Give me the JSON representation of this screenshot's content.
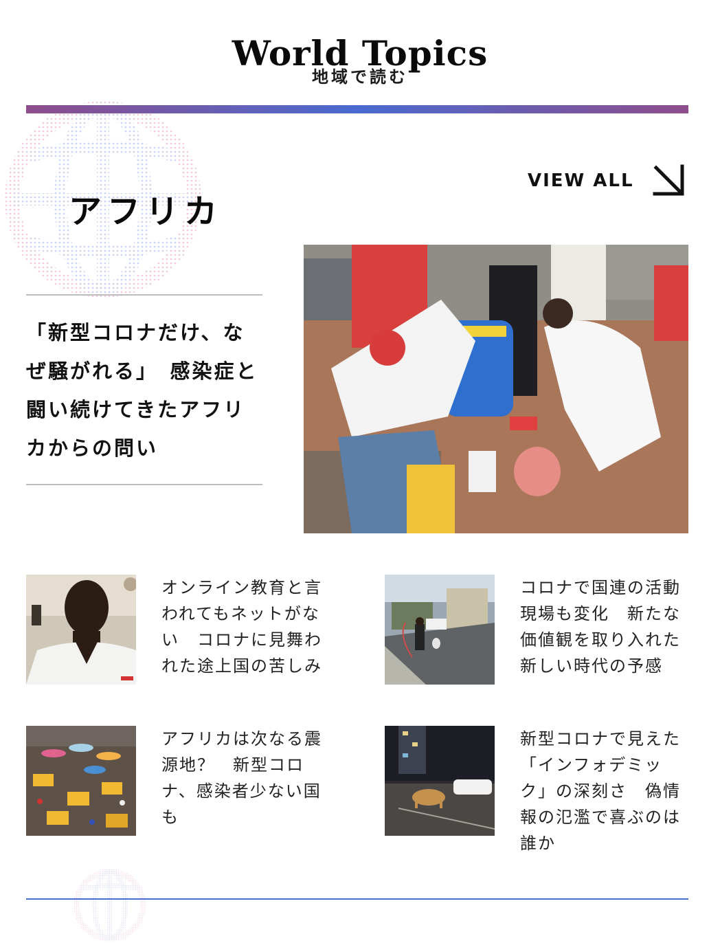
{
  "header": {
    "title": "World Topics",
    "subtitle": "地域で読む"
  },
  "section": {
    "title": "アフリカ",
    "view_all_label": "VIEW ALL",
    "view_all_icon": "arrow-down-right-icon"
  },
  "featured": {
    "title": "「新型コロナだけ、なぜ騒がれる」　感染症と闘い続けてきたアフリカからの問い"
  },
  "articles": [
    {
      "title": "オンライン教育と言われてもネットがない　コロナに見舞われた途上国の苦しみ"
    },
    {
      "title": "コロナで国連の活動現場も変化　新たな価値観を取り入れた新しい時代の予感"
    },
    {
      "title": "アフリカは次なる震源地？　新型コロナ、感染者少ない国も"
    },
    {
      "title": "新型コロナで見えた「インフォデミック」の深刻さ　偽情報の氾濫で喜ぶのは誰か"
    }
  ],
  "colors": {
    "gradient_start": "#8e4d8c",
    "gradient_mid": "#4a6bd0",
    "bottom_rule": "#4a6bd0",
    "globe_pink": "#e9a0c8",
    "globe_blue": "#a7b4e8"
  }
}
